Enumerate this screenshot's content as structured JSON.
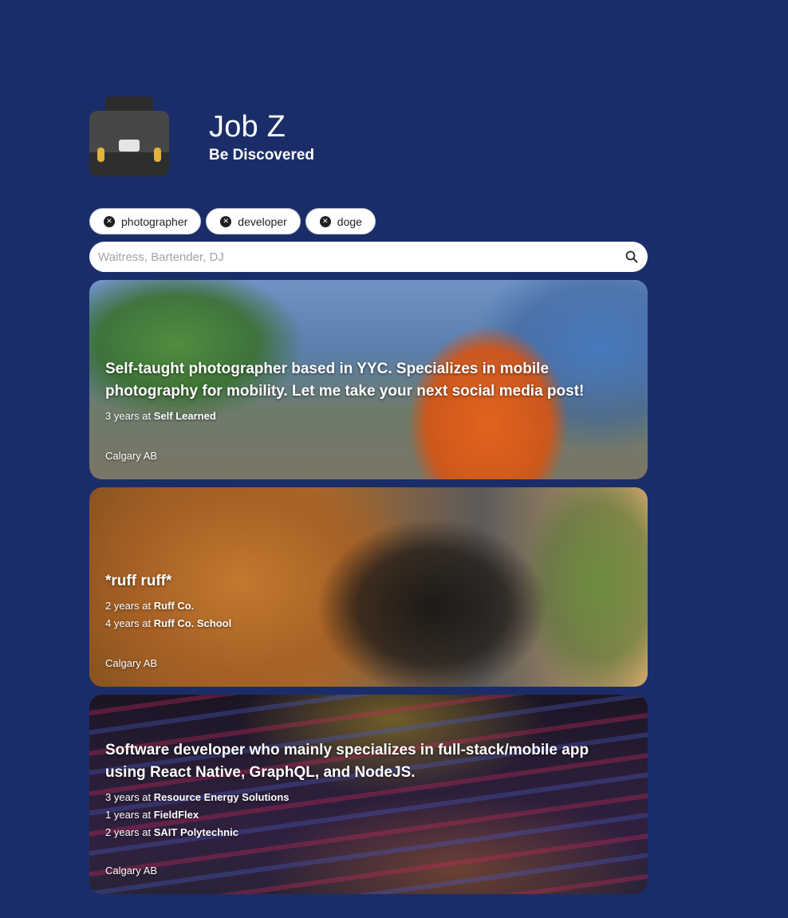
{
  "app": {
    "title": "Job Z",
    "subtitle": "Be Discovered",
    "logo_icon": "briefcase-icon"
  },
  "filters": [
    {
      "label": "photographer",
      "icon": "close-icon"
    },
    {
      "label": "developer",
      "icon": "close-icon"
    },
    {
      "label": "doge",
      "icon": "close-icon"
    }
  ],
  "search": {
    "placeholder": "Waitress, Bartender, DJ",
    "value": "",
    "icon": "search-icon"
  },
  "profiles": [
    {
      "description": "Self-taught photographer based in YYC. Specializes in mobile photography for mobility. Let me take your next social media post!",
      "experience": [
        {
          "years": "3",
          "prefix": "years at",
          "company": "Self Learned"
        }
      ],
      "location": "Calgary AB"
    },
    {
      "description": "*ruff ruff*",
      "experience": [
        {
          "years": "2",
          "prefix": "years at",
          "company": "Ruff Co."
        },
        {
          "years": "4",
          "prefix": "years at",
          "company": "Ruff Co. School"
        }
      ],
      "location": "Calgary AB"
    },
    {
      "description": "Software developer who mainly specializes in full-stack/mobile app using React Native, GraphQL, and NodeJS.",
      "experience": [
        {
          "years": "3",
          "prefix": "years at",
          "company": "Resource Energy Solutions"
        },
        {
          "years": "1",
          "prefix": "years at",
          "company": "FieldFlex"
        },
        {
          "years": "2",
          "prefix": "years at",
          "company": "SAIT Polytechnic"
        }
      ],
      "location": "Calgary AB"
    }
  ],
  "colors": {
    "background": "#1b2d69",
    "chip_background": "#ffffff",
    "text_light": "#ffffff"
  }
}
